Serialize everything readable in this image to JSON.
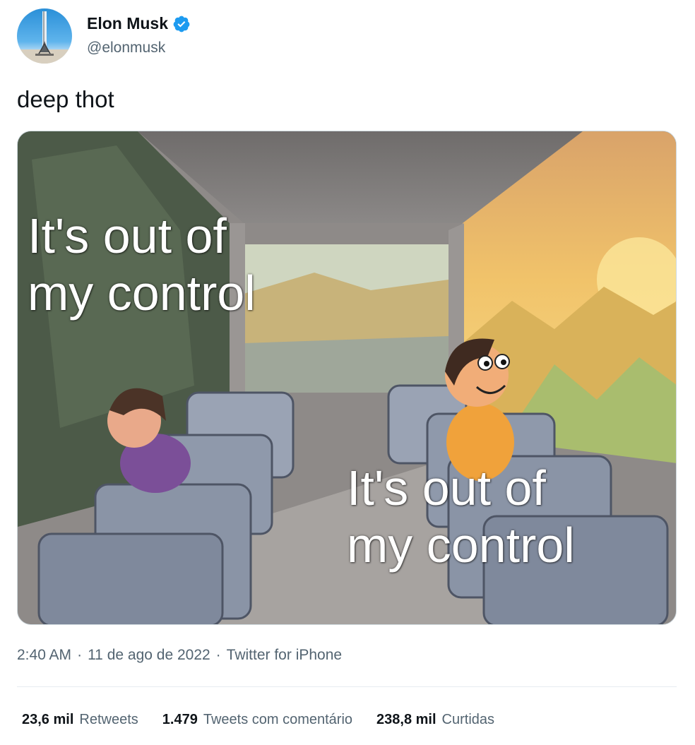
{
  "author": {
    "display_name": "Elon Musk",
    "handle": "@elonmusk",
    "verified": true,
    "verified_color": "#1d9bf0"
  },
  "tweet": {
    "text": "deep thot"
  },
  "media": {
    "caption_left": "It's out of\nmy control",
    "caption_right": "It's out of\nmy control",
    "caption_left_line1": "It's out of",
    "caption_left_line2": "my control",
    "caption_right_line1": "It's out of",
    "caption_right_line2": "my control"
  },
  "meta": {
    "time": "2:40 AM",
    "sep1": "·",
    "date": "11 de ago de 2022",
    "sep2": "·",
    "source": "Twitter for iPhone"
  },
  "stats": {
    "retweets_count": "23,6 mil",
    "retweets_label": "Retweets",
    "quotes_count": "1.479",
    "quotes_label": "Tweets com comentário",
    "likes_count": "238,8 mil",
    "likes_label": "Curtidas"
  }
}
